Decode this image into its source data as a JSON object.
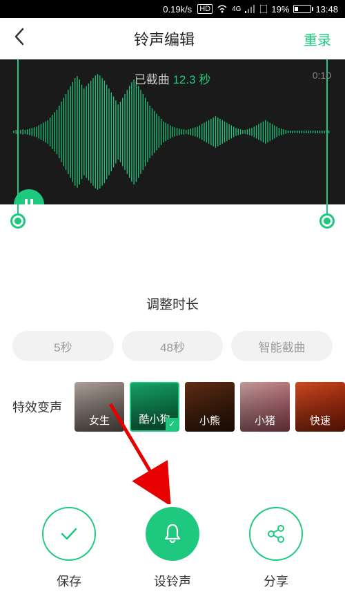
{
  "status": {
    "speed": "0.19k/s",
    "hd": "HD",
    "network": "4G",
    "battery_pct": "19%",
    "time": "13:48"
  },
  "nav": {
    "title": "铃声编辑",
    "rerecord": "重录"
  },
  "waveform": {
    "trimmed_prefix": "已截曲",
    "trimmed_seconds": "12.3 秒",
    "total_time": "0:10"
  },
  "adjust": {
    "title": "调整时长",
    "options": [
      "5秒",
      "48秒",
      "智能截曲"
    ]
  },
  "effects": {
    "label": "特效变声",
    "items": [
      {
        "name": "女生",
        "key": "girl"
      },
      {
        "name": "酷小狗",
        "key": "dog",
        "selected": true
      },
      {
        "name": "小熊",
        "key": "bear"
      },
      {
        "name": "小猪",
        "key": "pig"
      },
      {
        "name": "快速",
        "key": "fast"
      }
    ]
  },
  "actions": {
    "save": "保存",
    "set_ringtone": "设铃声",
    "share": "分享"
  }
}
